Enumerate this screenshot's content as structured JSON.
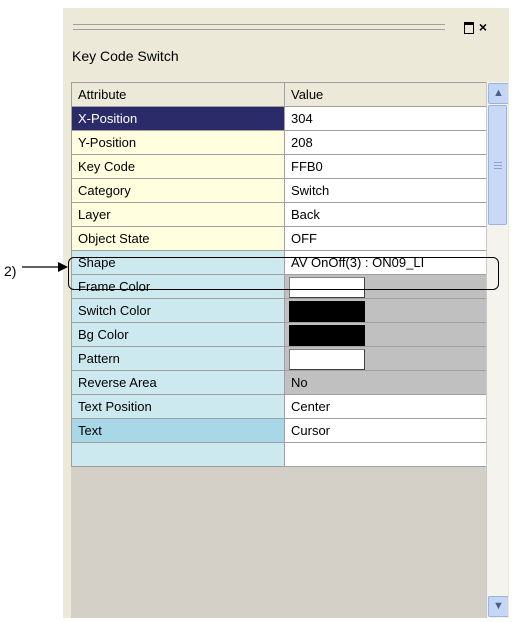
{
  "panel": {
    "title": "Key Code Switch"
  },
  "callout": {
    "label": "2)"
  },
  "grid": {
    "headers": {
      "attribute": "Attribute",
      "value": "Value"
    },
    "rows": [
      {
        "attribute": "X-Position",
        "value": "304"
      },
      {
        "attribute": "Y-Position",
        "value": "208"
      },
      {
        "attribute": "Key Code",
        "value": "FFB0"
      },
      {
        "attribute": "Category",
        "value": "Switch"
      },
      {
        "attribute": "Layer",
        "value": "Back"
      },
      {
        "attribute": "Object State",
        "value": "OFF"
      },
      {
        "attribute": "Shape",
        "value": "AV OnOff(3) : ON09_LI"
      },
      {
        "attribute": "Frame Color",
        "value": ""
      },
      {
        "attribute": "Switch Color",
        "value": ""
      },
      {
        "attribute": "Bg Color",
        "value": ""
      },
      {
        "attribute": "Pattern",
        "value": ""
      },
      {
        "attribute": "Reverse Area",
        "value": "No"
      },
      {
        "attribute": "Text Position",
        "value": "Center"
      },
      {
        "attribute": "Text",
        "value": "Cursor"
      }
    ],
    "swatch_colors": {
      "frame_color": "#FFFFFF",
      "switch_color": "#000000",
      "bg_color": "#000000",
      "pattern": "#FFFFFF"
    }
  },
  "icons": {
    "restore": "restore-icon",
    "close": "close-icon",
    "scroll_up": "scroll-up-arrow-icon",
    "scroll_down": "scroll-down-arrow-icon"
  }
}
